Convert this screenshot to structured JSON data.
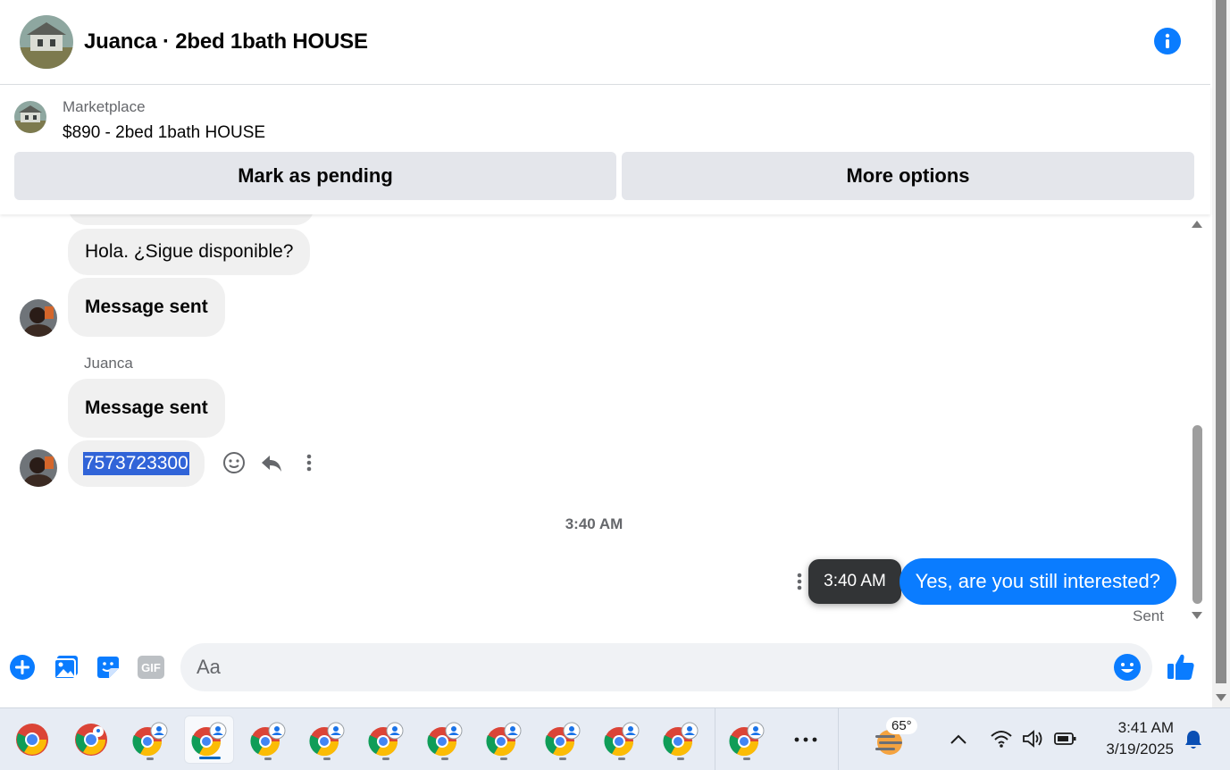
{
  "header": {
    "title": "Juanca · 2bed 1bath HOUSE",
    "info_icon": "info-icon"
  },
  "marketplace": {
    "label": "Marketplace",
    "title": "$890 - 2bed 1bath HOUSE",
    "buttons": {
      "pending": "Mark as pending",
      "more": "More options"
    }
  },
  "messages": {
    "first": "Hola. ¿Sigue disponible?",
    "second": "Message sent",
    "sender_name": "Juanca",
    "third": "Message sent",
    "fourth": "7573723300",
    "timestamp": "3:40 AM",
    "outgoing": "Yes, are you still interested?",
    "tooltip": "3:40 AM",
    "status": "Sent"
  },
  "composer": {
    "placeholder": "Aa"
  },
  "taskbar": {
    "weather_temp": "65°",
    "time": "3:41 AM",
    "date": "3/19/2025"
  },
  "colors": {
    "messenger_blue": "#0a7cff",
    "bubble_gray": "#f0f0f0",
    "selection": "#3164d8"
  }
}
